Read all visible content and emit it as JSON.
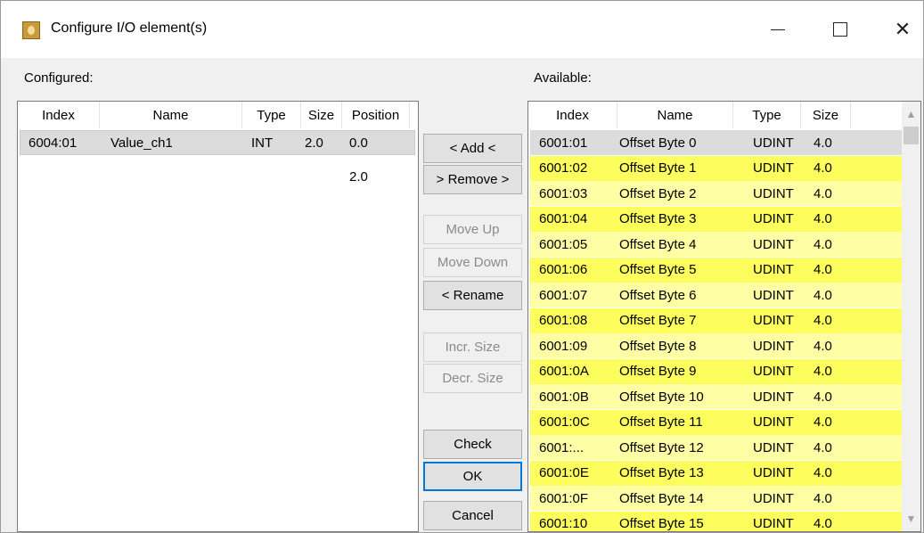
{
  "window": {
    "title": "Configure I/O element(s)"
  },
  "configured": {
    "label": "Configured:",
    "columns": [
      "Index",
      "Name",
      "Type",
      "Size",
      "Position"
    ],
    "rows": [
      {
        "index": "6004:01",
        "name": "Value_ch1",
        "type": "INT",
        "size": "2.0",
        "position": "0.0"
      }
    ],
    "next_position": "2.0"
  },
  "available": {
    "label": "Available:",
    "columns": [
      "Index",
      "Name",
      "Type",
      "Size"
    ],
    "rows": [
      {
        "index": "6001:01",
        "name": "Offset Byte 0",
        "type": "UDINT",
        "size": "4.0"
      },
      {
        "index": "6001:02",
        "name": "Offset Byte 1",
        "type": "UDINT",
        "size": "4.0"
      },
      {
        "index": "6001:03",
        "name": "Offset Byte 2",
        "type": "UDINT",
        "size": "4.0"
      },
      {
        "index": "6001:04",
        "name": "Offset Byte 3",
        "type": "UDINT",
        "size": "4.0"
      },
      {
        "index": "6001:05",
        "name": "Offset Byte 4",
        "type": "UDINT",
        "size": "4.0"
      },
      {
        "index": "6001:06",
        "name": "Offset Byte 5",
        "type": "UDINT",
        "size": "4.0"
      },
      {
        "index": "6001:07",
        "name": "Offset Byte 6",
        "type": "UDINT",
        "size": "4.0"
      },
      {
        "index": "6001:08",
        "name": "Offset Byte 7",
        "type": "UDINT",
        "size": "4.0"
      },
      {
        "index": "6001:09",
        "name": "Offset Byte 8",
        "type": "UDINT",
        "size": "4.0"
      },
      {
        "index": "6001:0A",
        "name": "Offset Byte 9",
        "type": "UDINT",
        "size": "4.0"
      },
      {
        "index": "6001:0B",
        "name": "Offset Byte 10",
        "type": "UDINT",
        "size": "4.0"
      },
      {
        "index": "6001:0C",
        "name": "Offset Byte 11",
        "type": "UDINT",
        "size": "4.0"
      },
      {
        "index": "6001:...",
        "name": "Offset Byte 12",
        "type": "UDINT",
        "size": "4.0"
      },
      {
        "index": "6001:0E",
        "name": "Offset Byte 13",
        "type": "UDINT",
        "size": "4.0"
      },
      {
        "index": "6001:0F",
        "name": "Offset Byte 14",
        "type": "UDINT",
        "size": "4.0"
      },
      {
        "index": "6001:10",
        "name": "Offset Byte 15",
        "type": "UDINT",
        "size": "4.0"
      }
    ]
  },
  "buttons": {
    "add": "< Add <",
    "remove": "> Remove >",
    "move_up": "Move Up",
    "move_down": "Move Down",
    "rename": "< Rename",
    "incr_size": "Incr. Size",
    "decr_size": "Decr. Size",
    "check": "Check",
    "ok": "OK",
    "cancel": "Cancel"
  },
  "colors": {
    "row_yellow_strong": "#fdfd5e",
    "row_yellow_light": "#fefea4",
    "row_selected": "#dcdcdc",
    "default_button_border": "#0078d7"
  },
  "icons": {
    "app": "app-gear-icon",
    "minimize": "minimize-icon",
    "maximize": "maximize-icon",
    "close": "close-icon",
    "scroll_up": "scroll-up-icon",
    "scroll_down": "scroll-down-icon"
  }
}
